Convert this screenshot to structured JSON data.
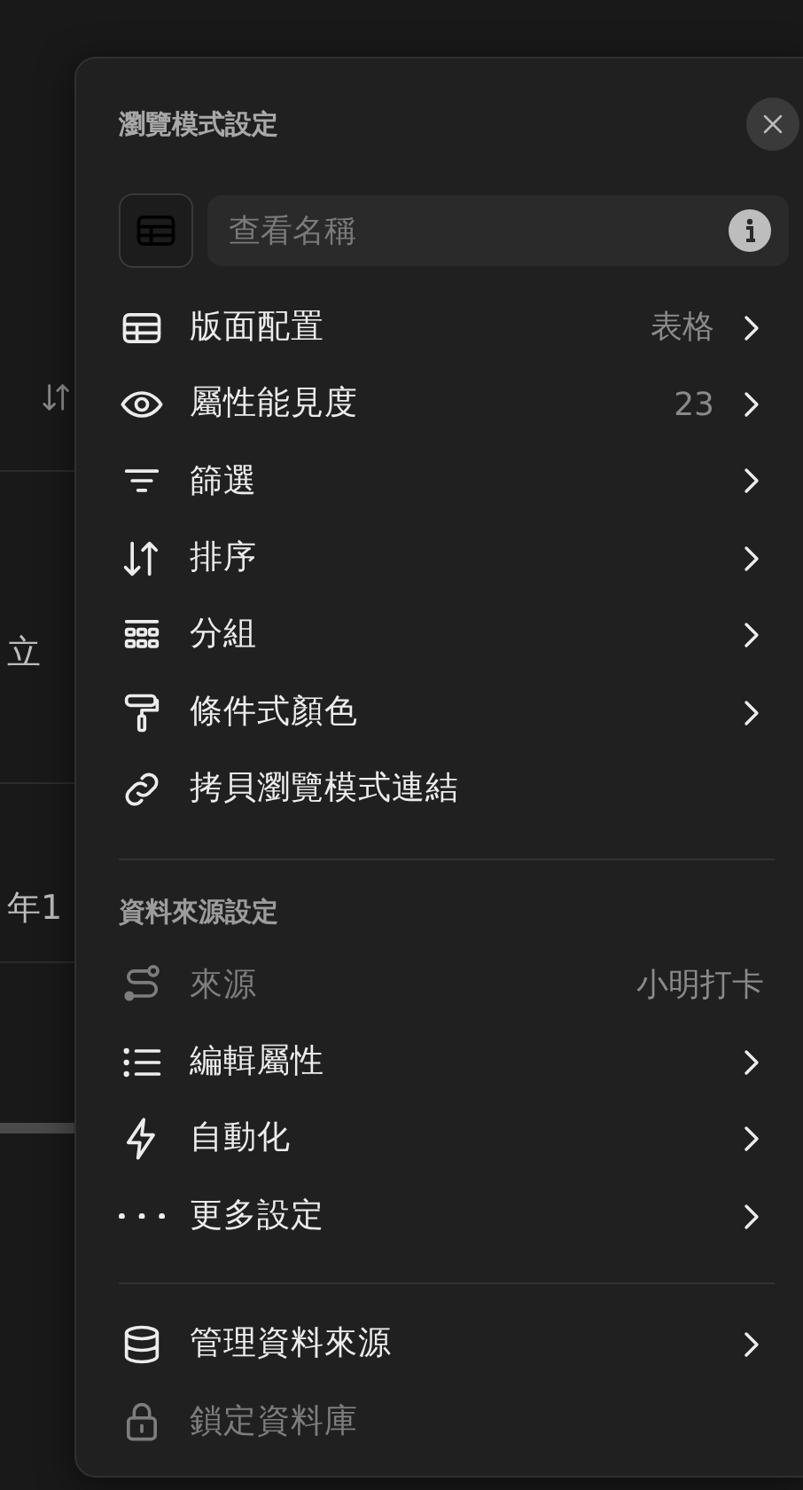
{
  "background": {
    "texts": [
      "立",
      "年1"
    ]
  },
  "panel": {
    "title": "瀏覽模式設定",
    "search": {
      "placeholder": "查看名稱"
    },
    "view_items": [
      {
        "label": "版面配置",
        "value": "表格",
        "chevron": true,
        "disabled": false
      },
      {
        "label": "屬性能見度",
        "value": "23",
        "chevron": true,
        "disabled": false
      },
      {
        "label": "篩選",
        "chevron": true,
        "disabled": false
      },
      {
        "label": "排序",
        "chevron": true,
        "disabled": false
      },
      {
        "label": "分組",
        "chevron": true,
        "disabled": false
      },
      {
        "label": "條件式顏色",
        "chevron": true,
        "disabled": false
      },
      {
        "label": "拷貝瀏覽模式連結",
        "chevron": false,
        "disabled": false
      }
    ],
    "source_title": "資料來源設定",
    "source_items": [
      {
        "label": "來源",
        "value": "小明打卡",
        "chevron": false,
        "disabled": true
      },
      {
        "label": "編輯屬性",
        "chevron": true,
        "disabled": false
      },
      {
        "label": "自動化",
        "chevron": true,
        "disabled": false
      },
      {
        "label": "更多設定",
        "chevron": true,
        "disabled": false
      }
    ],
    "db_items": [
      {
        "label": "管理資料來源",
        "chevron": true,
        "disabled": false
      },
      {
        "label": "鎖定資料庫",
        "chevron": false,
        "disabled": true
      }
    ]
  }
}
